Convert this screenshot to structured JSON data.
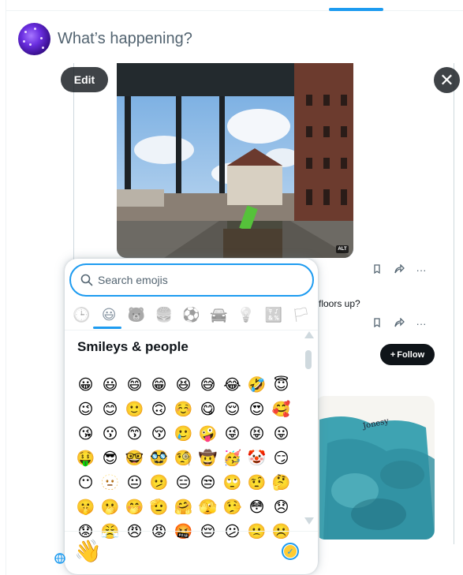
{
  "composer": {
    "placeholder": "What’s happening?"
  },
  "media": {
    "edit_label": "Edit",
    "close_icon": "✕",
    "alt_badge": "ALT"
  },
  "embed": {
    "snippet": "floors up?",
    "follow_label": "Follow",
    "follow_plus": "+",
    "signature": "Jonesy"
  },
  "emoji_picker": {
    "search_placeholder": "Search emojis",
    "categories": [
      {
        "name": "recent",
        "icon": "🕒"
      },
      {
        "name": "smileys-people",
        "icon": "😃"
      },
      {
        "name": "animals-nature",
        "icon": "🐻"
      },
      {
        "name": "food-drink",
        "icon": "🍔"
      },
      {
        "name": "activity",
        "icon": "⚽"
      },
      {
        "name": "travel-places",
        "icon": "🚘"
      },
      {
        "name": "objects",
        "icon": "💡"
      },
      {
        "name": "symbols",
        "icon": "🔣"
      },
      {
        "name": "flags",
        "icon": "🏳"
      }
    ],
    "active_category": "smileys-people",
    "section_title": "Smileys & people",
    "emojis": [
      "😀",
      "😃",
      "😄",
      "😁",
      "😆",
      "😅",
      "😂",
      "🤣",
      "😇",
      "😉",
      "😊",
      "🙂",
      "🙃",
      "☺️",
      "😋",
      "😌",
      "😍",
      "🥰",
      "😘",
      "😗",
      "😙",
      "😚",
      "🥲",
      "🤪",
      "😜",
      "😝",
      "😛",
      "🤑",
      "😎",
      "🤓",
      "🥸",
      "🧐",
      "🤠",
      "🥳",
      "🤡",
      "😏",
      "😶",
      "🫥",
      "😐",
      "🫤",
      "😑",
      "😒",
      "🙄",
      "🤨",
      "🤔",
      "🤫",
      "🫢",
      "🤭",
      "🫡",
      "🤗",
      "🫣",
      "🤥",
      "😳",
      "😞",
      "😟",
      "😤",
      "😠",
      "😡",
      "🤬",
      "😔",
      "😕",
      "🙁",
      "☹️"
    ],
    "footer_emoji": "👋",
    "skin_tone_check": "✓"
  },
  "colors": {
    "accent": "#1d9bf0",
    "dark_button": "#0f1419"
  }
}
